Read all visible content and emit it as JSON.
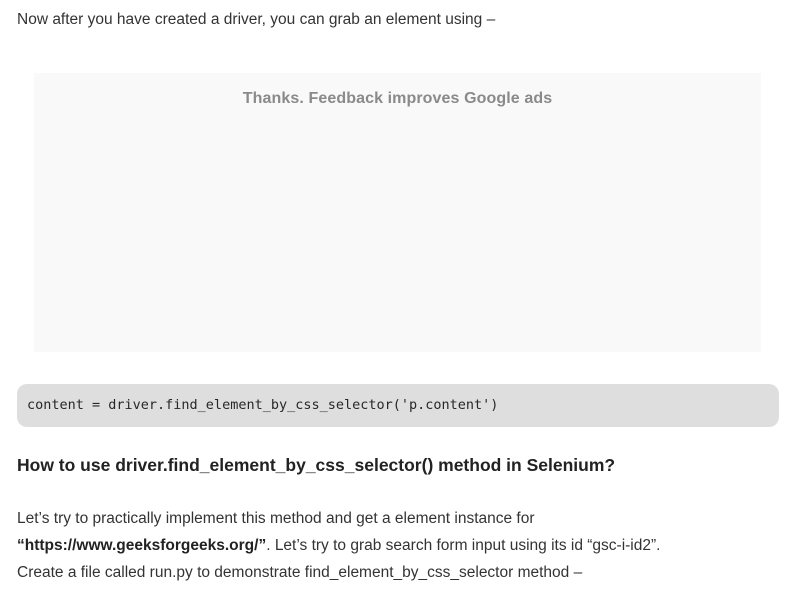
{
  "intro_text": "Now after you have created a driver, you can grab an element using –",
  "ad": {
    "feedback_text": "Thanks. Feedback improves Google ads"
  },
  "code": {
    "line1": "content = driver.find_element_by_css_selector('p.content')"
  },
  "heading": "How to use driver.find_element_by_css_selector() method in Selenium?",
  "paragraph": {
    "part1": "Let’s try to practically implement this method and get a element instance for",
    "url_bold": "“https://www.geeksforgeeks.org/”",
    "part2": ". Let’s try to grab search form input using its id “gsc-i-id2”.",
    "part3": "Create a file called run.py to demonstrate find_element_by_css_selector method –"
  }
}
